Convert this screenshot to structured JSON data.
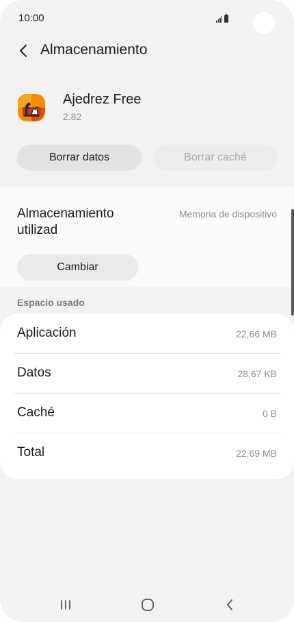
{
  "status_bar": {
    "time": "10:00"
  },
  "header": {
    "title": "Almacenamiento",
    "back_icon": "chevron-left-icon"
  },
  "app": {
    "name": "Ajedrez Free",
    "version": "2.82",
    "icon": "chess-app-icon"
  },
  "actions": {
    "clear_data": "Borrar datos",
    "clear_cache": "Borrar caché"
  },
  "storage": {
    "label": "Almacenamiento utilizad",
    "value": "Memoria de dispositivo",
    "change_button": "Cambiar"
  },
  "usage": {
    "section_title": "Espacio usado",
    "rows": [
      {
        "name": "Aplicación",
        "size": "22,66 MB"
      },
      {
        "name": "Datos",
        "size": "28,67 KB"
      },
      {
        "name": "Caché",
        "size": "0 B"
      },
      {
        "name": "Total",
        "size": "22,69 MB"
      }
    ]
  },
  "nav": {
    "recents_icon": "recents-icon",
    "home_icon": "home-icon",
    "back_icon": "back-icon"
  },
  "colors": {
    "background": "#f2f2f2",
    "card": "#ffffff",
    "secondary_text": "#8c8c8c",
    "disabled_text": "#a9a9a9"
  }
}
